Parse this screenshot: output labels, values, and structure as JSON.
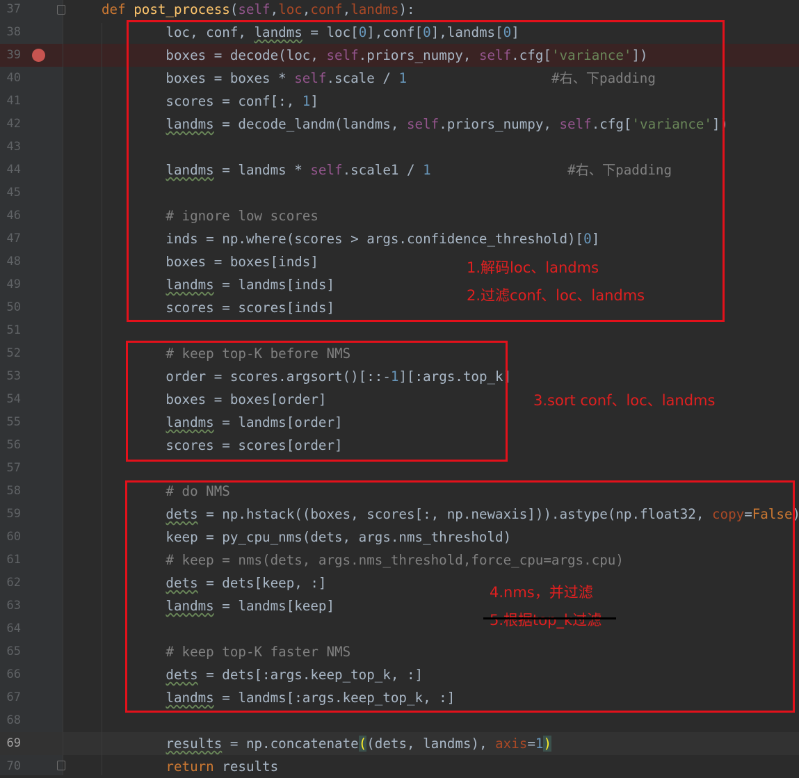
{
  "editor": {
    "colors": {
      "background": "#2b2b2b",
      "keyword": "#cc7832",
      "self": "#94558d",
      "number": "#6897bb",
      "string": "#6a8759",
      "comment": "#808080",
      "function_name": "#ffc66d",
      "annotation_red": "#e3111b"
    },
    "lines": [
      {
        "n": "37",
        "t": [
          [
            "kw",
            "def "
          ],
          [
            "fn",
            "post_process"
          ],
          [
            "",
            "("
          ],
          [
            "self",
            "self"
          ],
          [
            "",
            ","
          ],
          [
            "pm",
            "loc"
          ],
          [
            "",
            ","
          ],
          [
            "pm",
            "conf"
          ],
          [
            "",
            ","
          ],
          [
            "pm",
            "landms"
          ],
          [
            "",
            "):"
          ]
        ]
      },
      {
        "n": "38",
        "t": [
          [
            "",
            "        loc, conf, "
          ],
          [
            "wv",
            "landms"
          ],
          [
            "",
            " = loc["
          ],
          [
            "num",
            "0"
          ],
          [
            "",
            "],conf["
          ],
          [
            "num",
            "0"
          ],
          [
            "",
            "],landms["
          ],
          [
            "num",
            "0"
          ],
          [
            "",
            "]"
          ]
        ]
      },
      {
        "n": "39",
        "bp": true,
        "t": [
          [
            "",
            "        boxes = decode(loc, "
          ],
          [
            "self",
            "self"
          ],
          [
            "",
            ".priors_numpy, "
          ],
          [
            "self",
            "self"
          ],
          [
            "",
            ".cfg["
          ],
          [
            "str",
            "'variance'"
          ],
          [
            "",
            "])"
          ]
        ]
      },
      {
        "n": "40",
        "t": [
          [
            "",
            "        boxes = boxes * "
          ],
          [
            "self",
            "self"
          ],
          [
            "",
            ".scale / "
          ],
          [
            "num",
            "1"
          ],
          [
            "",
            "                  "
          ],
          [
            "cm",
            "#右、下padding"
          ]
        ]
      },
      {
        "n": "41",
        "t": [
          [
            "",
            "        scores = conf[:, "
          ],
          [
            "num",
            "1"
          ],
          [
            "",
            "]"
          ]
        ]
      },
      {
        "n": "42",
        "t": [
          [
            "",
            "        "
          ],
          [
            "wv",
            "landms"
          ],
          [
            "",
            " = decode_landm(landms, "
          ],
          [
            "self",
            "self"
          ],
          [
            "",
            ".priors_numpy, "
          ],
          [
            "self",
            "self"
          ],
          [
            "",
            ".cfg["
          ],
          [
            "str",
            "'variance'"
          ],
          [
            "",
            "])"
          ]
        ]
      },
      {
        "n": "43",
        "t": []
      },
      {
        "n": "44",
        "t": [
          [
            "",
            "        "
          ],
          [
            "wv",
            "landms"
          ],
          [
            "",
            " = landms * "
          ],
          [
            "self",
            "self"
          ],
          [
            "",
            ".scale1 / "
          ],
          [
            "num",
            "1"
          ],
          [
            "",
            "                 "
          ],
          [
            "cm",
            "#右、下padding"
          ]
        ]
      },
      {
        "n": "45",
        "t": []
      },
      {
        "n": "46",
        "t": [
          [
            "",
            "        "
          ],
          [
            "cm",
            "# ignore low scores"
          ]
        ]
      },
      {
        "n": "47",
        "t": [
          [
            "",
            "        inds = np.where(scores > args.confidence_threshold)["
          ],
          [
            "num",
            "0"
          ],
          [
            "",
            "]"
          ]
        ]
      },
      {
        "n": "48",
        "t": [
          [
            "",
            "        boxes = boxes[inds]"
          ]
        ]
      },
      {
        "n": "49",
        "t": [
          [
            "",
            "        "
          ],
          [
            "wv",
            "landms"
          ],
          [
            "",
            " = landms[inds]"
          ]
        ]
      },
      {
        "n": "50",
        "t": [
          [
            "",
            "        scores = scores[inds]"
          ]
        ]
      },
      {
        "n": "51",
        "t": []
      },
      {
        "n": "52",
        "t": [
          [
            "",
            "        "
          ],
          [
            "cm",
            "# keep top-K before NMS"
          ]
        ]
      },
      {
        "n": "53",
        "t": [
          [
            "",
            "        order = scores.argsort()[::-"
          ],
          [
            "num",
            "1"
          ],
          [
            "",
            "][:args.top_k]"
          ]
        ]
      },
      {
        "n": "54",
        "t": [
          [
            "",
            "        boxes = boxes[order]"
          ]
        ]
      },
      {
        "n": "55",
        "t": [
          [
            "",
            "        "
          ],
          [
            "wv",
            "landms"
          ],
          [
            "",
            " = landms[order]"
          ]
        ]
      },
      {
        "n": "56",
        "t": [
          [
            "",
            "        scores = scores[order]"
          ]
        ]
      },
      {
        "n": "57",
        "t": []
      },
      {
        "n": "58",
        "t": [
          [
            "",
            "        "
          ],
          [
            "cm",
            "# do NMS"
          ]
        ]
      },
      {
        "n": "59",
        "t": [
          [
            "",
            "        "
          ],
          [
            "wv",
            "dets"
          ],
          [
            "",
            " = np.hstack((boxes, scores[:, np.newaxis])).astype(np.float32, "
          ],
          [
            "pm",
            "copy"
          ],
          [
            "",
            "="
          ],
          [
            "kw",
            "False"
          ],
          [
            "",
            ")"
          ]
        ]
      },
      {
        "n": "60",
        "t": [
          [
            "",
            "        keep = py_cpu_nms(dets, args.nms_threshold)"
          ]
        ]
      },
      {
        "n": "61",
        "t": [
          [
            "",
            "        "
          ],
          [
            "cm",
            "# keep = nms(dets, args.nms_threshold,force_cpu=args.cpu)"
          ]
        ]
      },
      {
        "n": "62",
        "t": [
          [
            "",
            "        "
          ],
          [
            "wv",
            "dets"
          ],
          [
            "",
            " = dets[keep, :]"
          ]
        ]
      },
      {
        "n": "63",
        "t": [
          [
            "",
            "        "
          ],
          [
            "wv",
            "landms"
          ],
          [
            "",
            " = landms[keep]"
          ]
        ]
      },
      {
        "n": "64",
        "t": []
      },
      {
        "n": "65",
        "t": [
          [
            "",
            "        "
          ],
          [
            "cm",
            "# keep top-K faster NMS"
          ]
        ]
      },
      {
        "n": "66",
        "t": [
          [
            "",
            "        "
          ],
          [
            "wv",
            "dets"
          ],
          [
            "",
            " = dets[:args.keep_top_k, :]"
          ]
        ]
      },
      {
        "n": "67",
        "t": [
          [
            "",
            "        "
          ],
          [
            "wv",
            "landms"
          ],
          [
            "",
            " = landms[:args.keep_top_k, :]"
          ]
        ]
      },
      {
        "n": "68",
        "t": []
      },
      {
        "n": "69",
        "cur": true,
        "t": [
          [
            "",
            "        "
          ],
          [
            "wv",
            "results"
          ],
          [
            "",
            " = np.concatenate"
          ],
          [
            "br",
            "("
          ],
          [
            "",
            "(dets, landms), "
          ],
          [
            "pm",
            "axis"
          ],
          [
            "",
            "="
          ],
          [
            "num",
            "1"
          ],
          [
            "br",
            ")"
          ]
        ]
      },
      {
        "n": "70",
        "t": [
          [
            "",
            "        "
          ],
          [
            "kw",
            "return "
          ],
          [
            "",
            "results"
          ]
        ]
      }
    ]
  },
  "annotations": {
    "note1": "1.解码loc、landms",
    "note2": "2.过滤conf、loc、landms",
    "note3": "3.sort conf、loc、landms",
    "note4": "4.nms，并过滤",
    "note5": "5.根据top_k过滤"
  }
}
